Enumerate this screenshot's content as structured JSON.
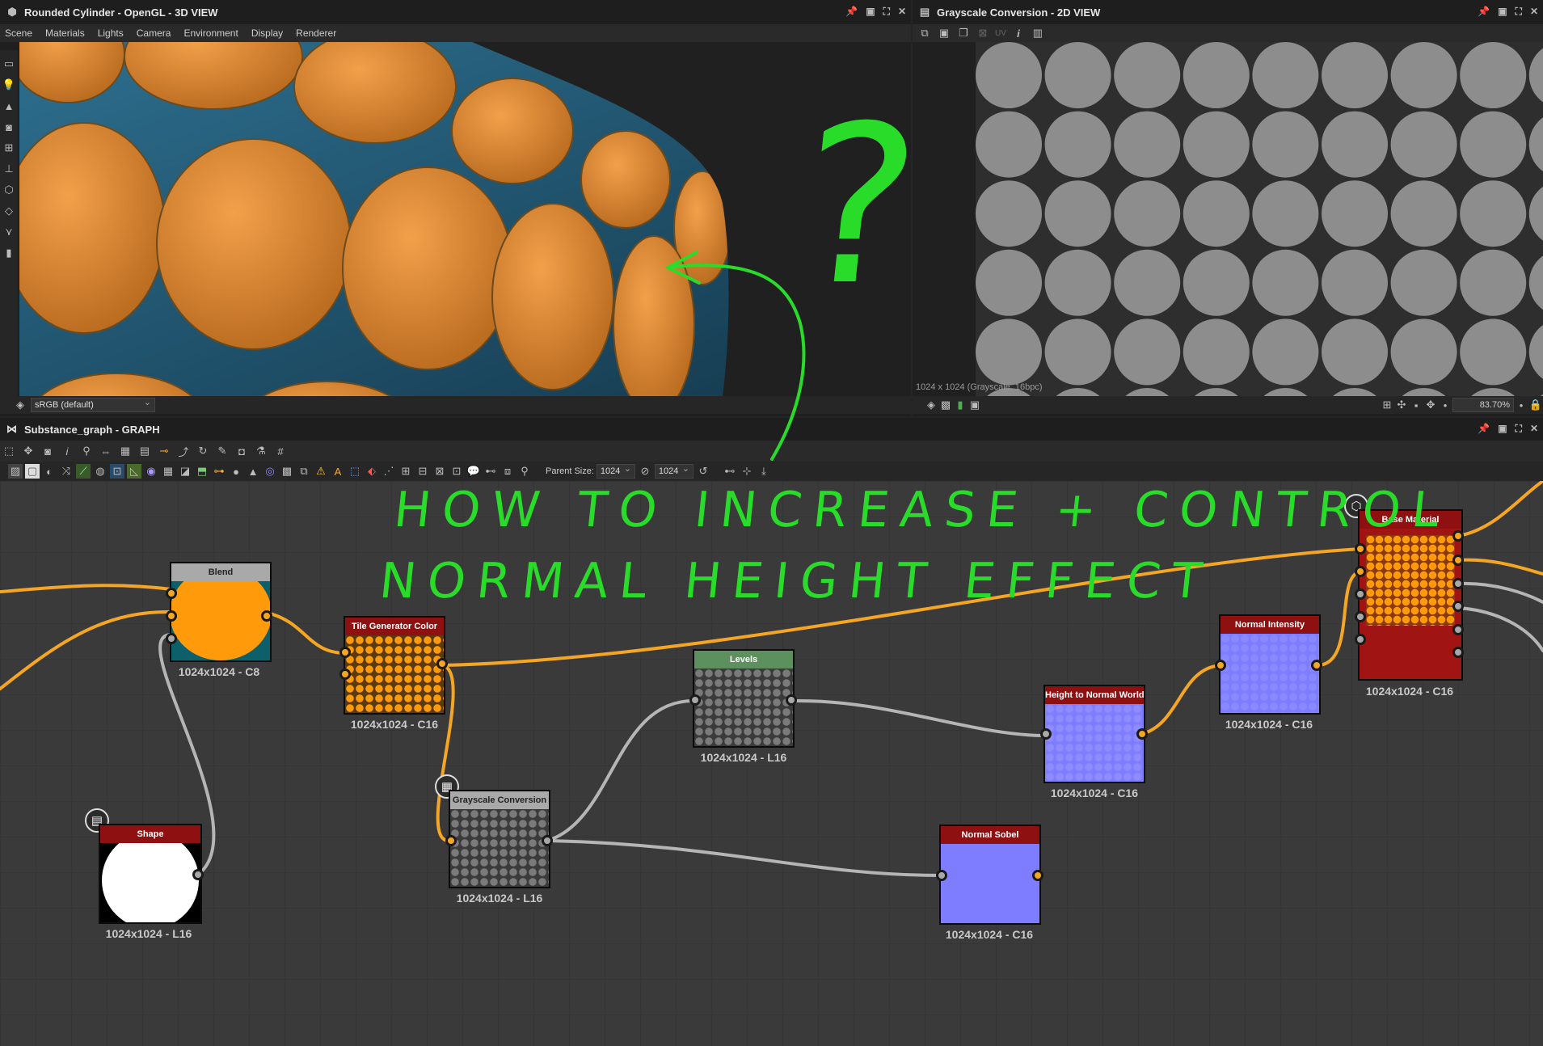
{
  "view3d": {
    "title": "Rounded Cylinder - OpenGL - 3D VIEW",
    "menu": [
      "Scene",
      "Materials",
      "Lights",
      "Camera",
      "Environment",
      "Display",
      "Renderer"
    ],
    "colorspace": "sRGB (default)"
  },
  "view2d": {
    "title": "Grayscale Conversion - 2D VIEW",
    "uv_label": "UV",
    "info_text": "1024 x 1024 (Grayscale, 16bpc)",
    "zoom": "83.70%"
  },
  "graph": {
    "title": "Substance_graph - GRAPH",
    "parent_size_label": "Parent Size:",
    "parent_size_value": "1024",
    "size_value": "1024"
  },
  "nodes": {
    "blend": {
      "title": "Blend",
      "res": "1024x1024 - C8"
    },
    "tile_generator": {
      "title": "Tile Generator Color",
      "res": "1024x1024 - C16"
    },
    "levels": {
      "title": "Levels",
      "res": "1024x1024 - L16"
    },
    "grayscale": {
      "title": "Grayscale Conversion",
      "res": "1024x1024 - L16"
    },
    "shape": {
      "title": "Shape",
      "res": "1024x1024 - L16"
    },
    "height_to_normal": {
      "title": "Height to Normal World...",
      "res": "1024x1024 - C16"
    },
    "normal_intensity": {
      "title": "Normal Intensity",
      "res": "1024x1024 - C16"
    },
    "normal_sobel": {
      "title": "Normal Sobel",
      "res": "1024x1024 - C16"
    },
    "base_material": {
      "title": "Base Material",
      "res": "1024x1024 - C16"
    }
  },
  "annotation": {
    "line1": "HOW TO INCREASE + CONTROL",
    "line2": "NORMAL HEIGHT EFFECT",
    "question": "?"
  },
  "colors": {
    "orange_wire": "#f5a623",
    "gray_wire": "#b5b5b5",
    "annotation_green": "#2adc2a",
    "node_header_red": "#8e1010",
    "node_header_gray": "#a9a9a9",
    "node_header_green": "#5e8f5e",
    "normal_blue": "#7f7dff"
  }
}
